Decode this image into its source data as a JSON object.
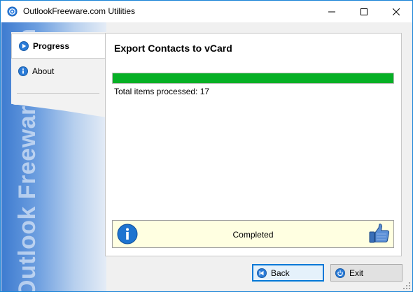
{
  "window": {
    "title": "OutlookFreeware.com Utilities",
    "app_icon": "app-icon"
  },
  "sidebar": {
    "brand": "Outlook Freeware .com",
    "items": [
      {
        "label": "Progress",
        "icon": "play-circle-icon",
        "active": true
      },
      {
        "label": "About",
        "icon": "info-icon",
        "active": false
      }
    ]
  },
  "main": {
    "title": "Export Contacts to vCard",
    "progress_percent": 100,
    "processed_text": "Total items processed: 17",
    "status_text": "Completed"
  },
  "buttons": {
    "back_label": "Back",
    "exit_label": "Exit"
  },
  "colors": {
    "accent": "#1883d7",
    "progress": "#06b025",
    "status_bg": "#ffffe1"
  }
}
